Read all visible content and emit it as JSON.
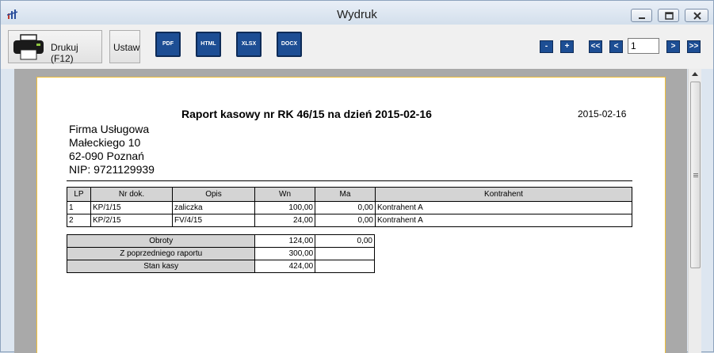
{
  "window": {
    "title": "Wydruk"
  },
  "toolbar": {
    "print_label": "Drukuj (F12)",
    "settings_label": "Ustaw",
    "formats": [
      "PDF",
      "HTML",
      "XLSX",
      "DOCX"
    ],
    "zoom_out": "-",
    "zoom_in": "+",
    "first_page": "<<",
    "prev_page": "<",
    "page_number": "1",
    "next_page": ">",
    "last_page": ">>"
  },
  "report": {
    "title": "Raport kasowy nr RK 46/15 na dzień 2015-02-16",
    "date": "2015-02-16",
    "company": [
      "Firma Usługowa",
      "Małeckiego 10",
      "62-090 Poznań",
      "NIP: 9721129939"
    ],
    "columns": [
      "LP",
      "Nr dok.",
      "Opis",
      "Wn",
      "Ma",
      "Kontrahent"
    ],
    "rows": [
      [
        "1",
        "KP/1/15",
        "zaliczka",
        "100,00",
        "0,00",
        "Kontrahent A"
      ],
      [
        "2",
        "KP/2/15",
        "FV/4/15",
        "24,00",
        "0,00",
        "Kontrahent A"
      ]
    ],
    "summary": [
      {
        "label": "Obroty",
        "wn": "124,00",
        "ma": "0,00"
      },
      {
        "label": "Z poprzedniego raportu",
        "wn": "300,00",
        "ma": ""
      },
      {
        "label": "Stan kasy",
        "wn": "424,00",
        "ma": ""
      }
    ]
  }
}
